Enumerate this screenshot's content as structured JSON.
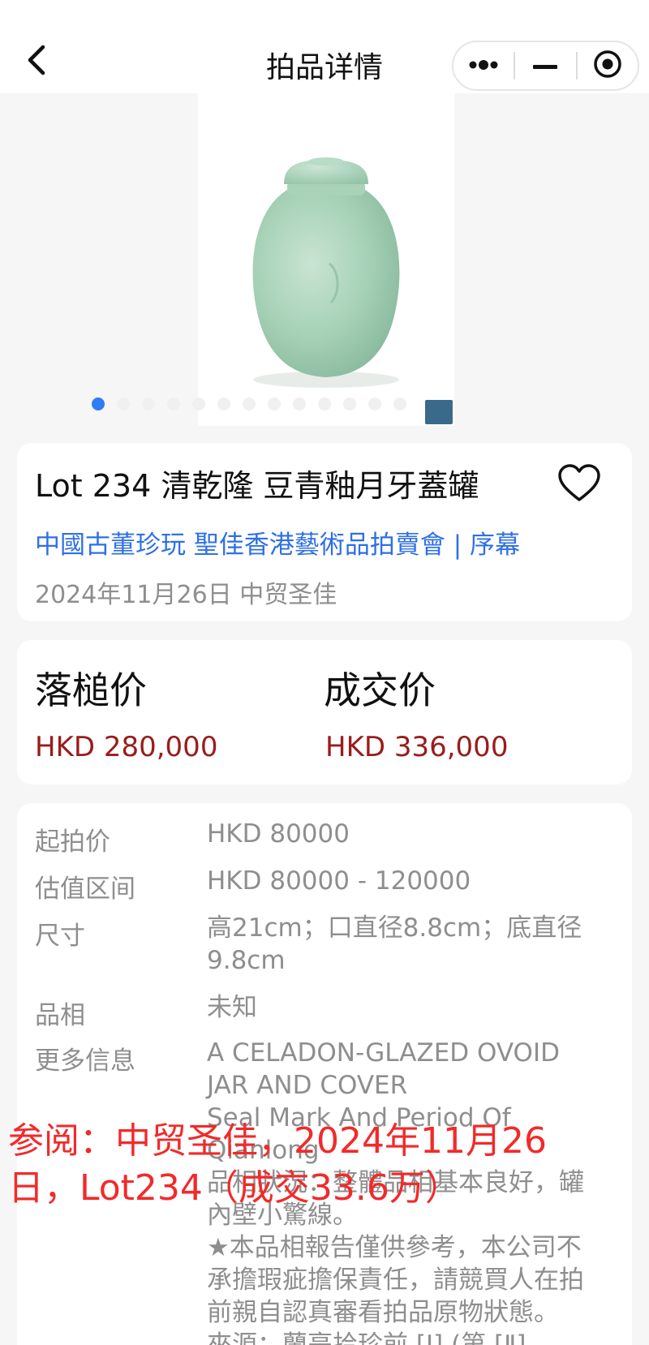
{
  "header": {
    "title": "拍品详情",
    "back_icon": "chevron-left-icon",
    "capsule_icons": [
      "more-dots-icon",
      "minimize-icon",
      "close-target-icon"
    ]
  },
  "gallery": {
    "image_description_icon": "celadon-jar-photo",
    "dot_count": 13,
    "active_index": 0,
    "active_color": "#2f7cf6"
  },
  "lot": {
    "title": "Lot 234 清乾隆 豆青釉月牙蓋罐",
    "sale_link": "中國古董珍玩 聖佳香港藝術品拍賣會 | 序幕",
    "meta": "2024年11月26日 中贸圣佳",
    "favorite_icon": "heart-outline-icon"
  },
  "prices": {
    "hammer_label": "落槌价",
    "hammer_value": "HKD 280,000",
    "final_label": "成交价",
    "final_value": "HKD 336,000",
    "value_color": "#9a1c1c"
  },
  "details": {
    "start_label": "起拍价",
    "start_value": "HKD 80000",
    "estimate_label": "估值区间",
    "estimate_value": "HKD 80000 - 120000",
    "size_label": "尺寸",
    "size_value": "高21cm；口直径8.8cm；底直径9.8cm",
    "condition_label": "品相",
    "condition_value": "未知",
    "more_label": "更多信息",
    "more_lines": [
      "A CELADON-GLAZED OVOID",
      "JAR AND COVER",
      "Seal Mark And Period Of",
      "Qianlong",
      "品相狀況：整體品相基本良好，罐",
      "內壁小驚線。",
      "★本品相報告僅供參考，本公司不",
      "承擔瑕疵擔保責任，請競買人在拍",
      "前親自認真審看拍品原物狀態。",
      "來源：蘭亭拾珍前 [Ⅰ] (第 [Ⅱ]"
    ]
  },
  "watermark": {
    "line1": "参阅：中贸圣佳，2024年11月26",
    "line2": "日，Lot234（成交33.6万）"
  }
}
